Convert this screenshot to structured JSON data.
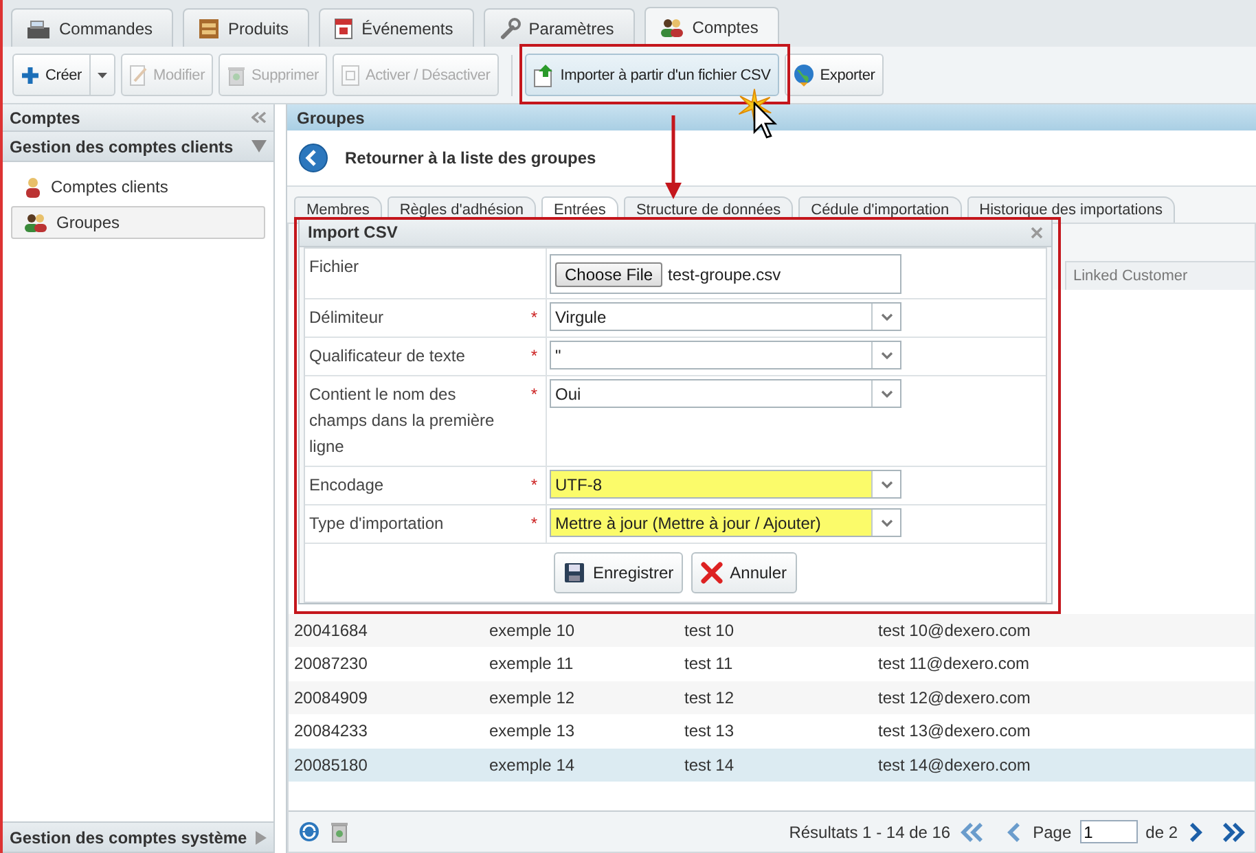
{
  "main_tabs": [
    {
      "label": "Commandes",
      "selected": false
    },
    {
      "label": "Produits",
      "selected": false
    },
    {
      "label": "Événements",
      "selected": false
    },
    {
      "label": "Paramètres",
      "selected": false
    },
    {
      "label": "Comptes",
      "selected": true
    }
  ],
  "toolbar": {
    "buttons": [
      {
        "label": "Créer",
        "kind": "split",
        "disabled": false,
        "highlighted": false
      },
      {
        "label": "Modifier",
        "kind": "plain",
        "disabled": true,
        "highlighted": false
      },
      {
        "label": "Supprimer",
        "kind": "plain",
        "disabled": true,
        "highlighted": false
      },
      {
        "label": "Activer / Désactiver",
        "kind": "plain",
        "disabled": true,
        "highlighted": false
      },
      {
        "label": "Importer à partir d'un fichier CSV",
        "kind": "plain",
        "disabled": false,
        "highlighted": true
      },
      {
        "label": "Exporter",
        "kind": "plain",
        "disabled": false,
        "highlighted": false
      }
    ]
  },
  "sidebar": {
    "title": "Comptes",
    "sections": [
      {
        "label": "Gestion des comptes clients",
        "expanded": true,
        "items": [
          {
            "label": "Comptes clients",
            "selected": false
          },
          {
            "label": "Groupes",
            "selected": true
          }
        ]
      },
      {
        "label": "Gestion des comptes système",
        "expanded": false
      }
    ]
  },
  "content": {
    "title": "Groupes",
    "back_link": "Retourner à la liste des groupes",
    "tabs": [
      {
        "label": "Membres",
        "selected": false
      },
      {
        "label": "Règles d'adhésion",
        "selected": false
      },
      {
        "label": "Entrées",
        "selected": true
      },
      {
        "label": "Structure de données",
        "selected": false
      },
      {
        "label": "Cédule d'importation",
        "selected": false
      },
      {
        "label": "Historique des importations",
        "selected": false
      }
    ],
    "grid": {
      "column_5_header": "Linked Customer",
      "rows": [
        {
          "cells": [
            "20041684",
            "exemple 10",
            "test 10",
            "test 10@dexero.com"
          ],
          "selected": false
        },
        {
          "cells": [
            "20087230",
            "exemple 11",
            "test 11",
            "test 11@dexero.com"
          ],
          "selected": false
        },
        {
          "cells": [
            "20084909",
            "exemple 12",
            "test 12",
            "test 12@dexero.com"
          ],
          "selected": false
        },
        {
          "cells": [
            "20084233",
            "exemple 13",
            "test 13",
            "test 13@dexero.com"
          ],
          "selected": false
        },
        {
          "cells": [
            "20085180",
            "exemple 14",
            "test 14",
            "test 14@dexero.com"
          ],
          "selected": true
        }
      ]
    },
    "pager": {
      "results": "Résultats 1 - 14 de 16",
      "page_label": "Page",
      "page_value": "1",
      "page_total": "de 2"
    }
  },
  "dialog": {
    "title": "Import CSV",
    "required_mark": "*",
    "fields": [
      {
        "label": "Fichier",
        "required": false,
        "kind": "file",
        "button": "Choose File",
        "value": "test-groupe.csv",
        "highlighted": false
      },
      {
        "label": "Délimiteur",
        "required": true,
        "kind": "select",
        "value": "Virgule",
        "highlighted": false
      },
      {
        "label": "Qualificateur de texte",
        "required": true,
        "kind": "select",
        "value": "\"",
        "highlighted": false
      },
      {
        "label": "Contient le nom des champs dans la première ligne",
        "required": true,
        "kind": "select",
        "value": "Oui",
        "highlighted": false
      },
      {
        "label": "Encodage",
        "required": true,
        "kind": "select",
        "value": "UTF-8",
        "highlighted": true
      },
      {
        "label": "Type d'importation",
        "required": true,
        "kind": "select",
        "value": "Mettre à jour (Mettre à jour / Ajouter)",
        "highlighted": true
      }
    ],
    "buttons": [
      "Enregistrer",
      "Annuler"
    ]
  }
}
